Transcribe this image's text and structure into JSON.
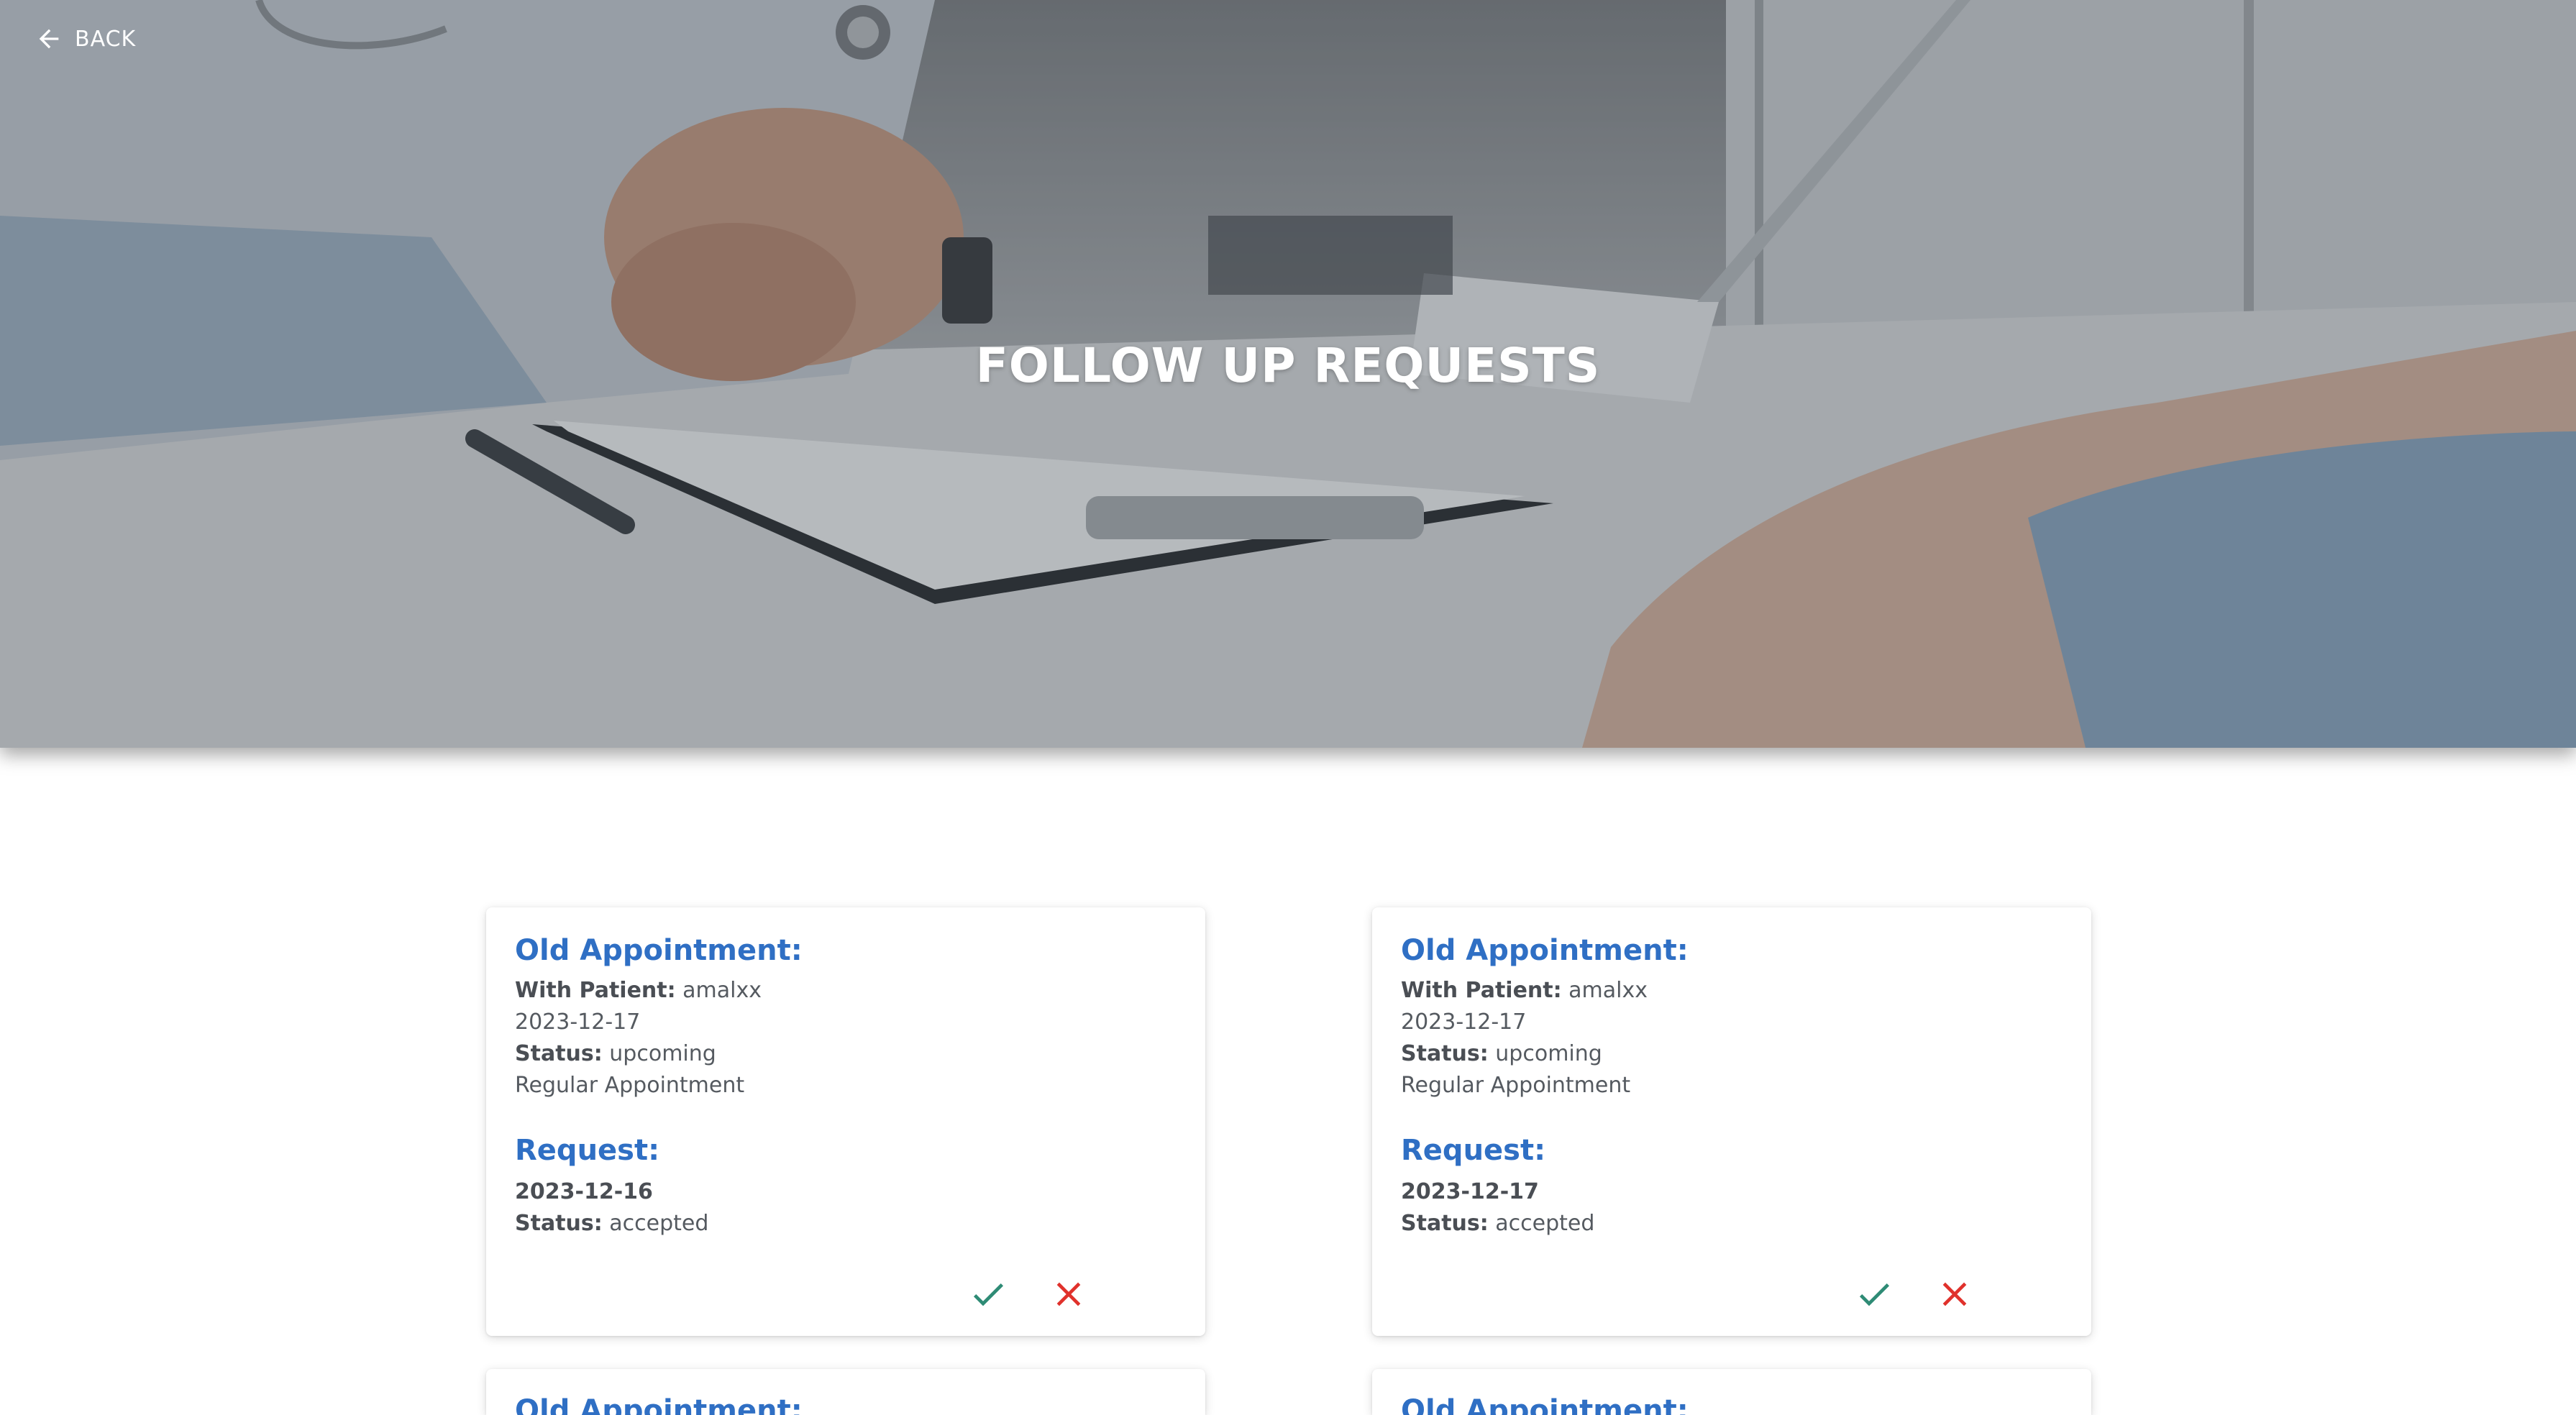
{
  "header": {
    "back_label": "BACK",
    "title": "FOLLOW UP REQUESTS"
  },
  "icons": {
    "back": "arrow-left-icon",
    "accept": "check-icon",
    "reject": "close-icon"
  },
  "colors": {
    "heading_blue": "#2f6fc4",
    "accept_green": "#2e8b75",
    "reject_red": "#e0312b"
  },
  "cards": [
    {
      "old_heading": "Old Appointment:",
      "patient_label": "With Patient:",
      "patient_name": "amalxx",
      "old_date": "2023-12-17",
      "status_label": "Status:",
      "old_status": "upcoming",
      "type": "Regular Appointment",
      "request_heading": "Request:",
      "request_date": "2023-12-16",
      "request_status_label": "Status:",
      "request_status": "accepted"
    },
    {
      "old_heading": "Old Appointment:",
      "patient_label": "With Patient:",
      "patient_name": "amalxx",
      "old_date": "2023-12-17",
      "status_label": "Status:",
      "old_status": "upcoming",
      "type": "Regular Appointment",
      "request_heading": "Request:",
      "request_date": "2023-12-17",
      "request_status_label": "Status:",
      "request_status": "accepted"
    },
    {
      "old_heading": "Old Appointment:"
    },
    {
      "old_heading": "Old Appointment:"
    }
  ]
}
